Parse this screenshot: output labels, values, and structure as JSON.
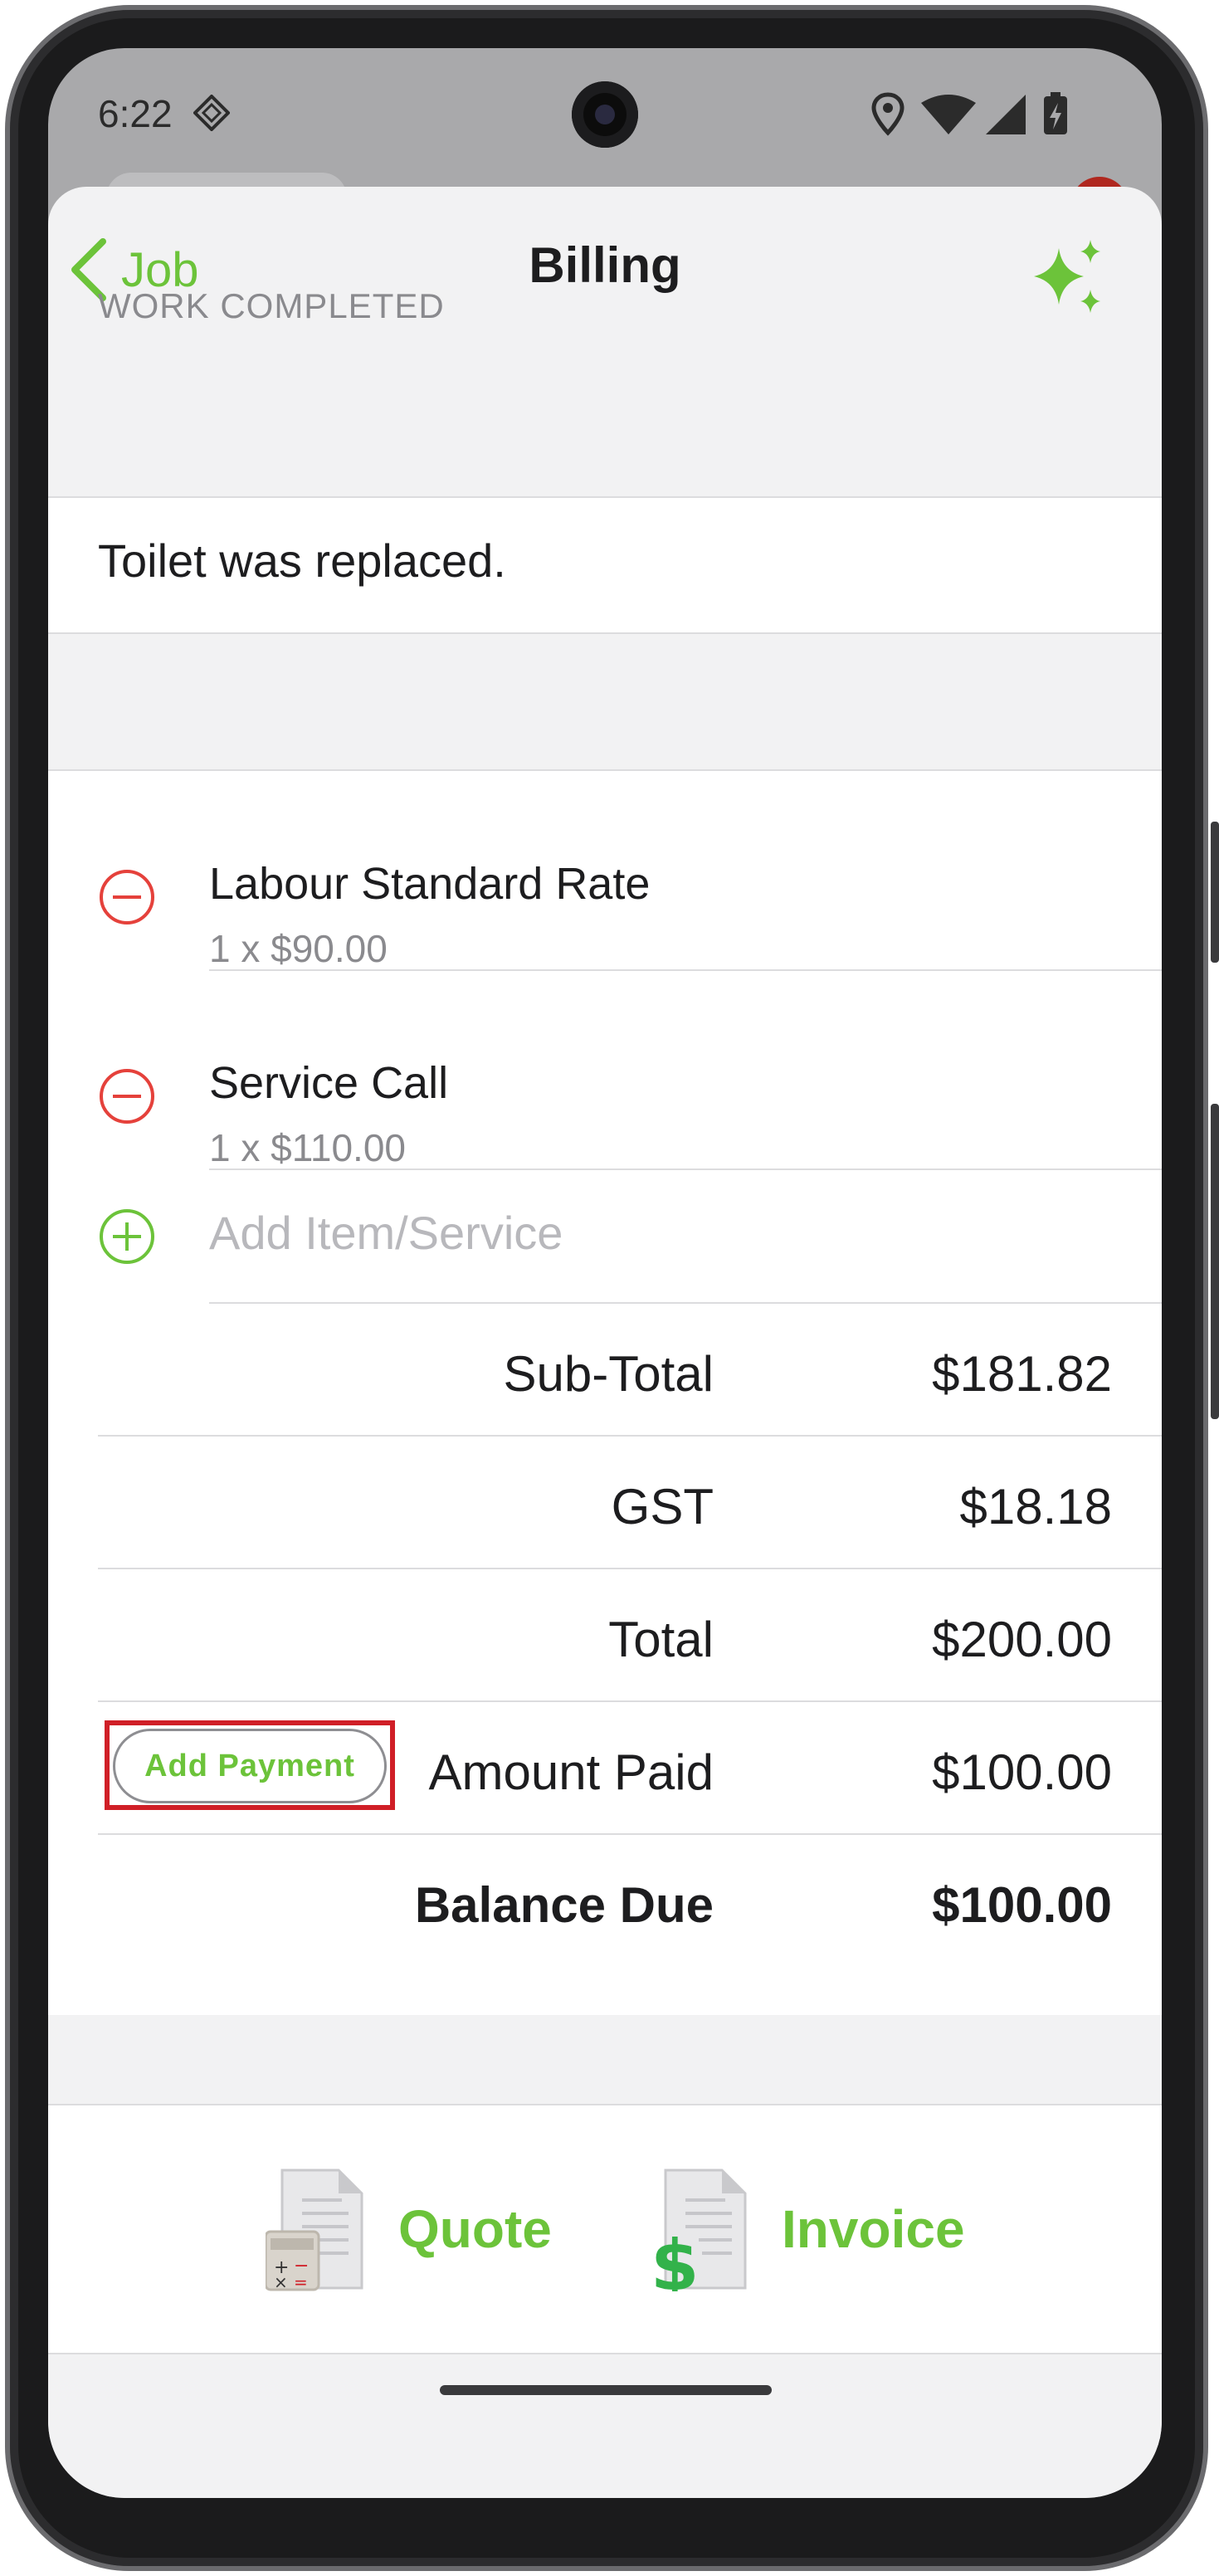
{
  "status_bar": {
    "time": "6:22"
  },
  "nav": {
    "back_label": "Job",
    "title": "Billing"
  },
  "work_completed": {
    "header": "WORK COMPLETED",
    "text": "Toilet was replaced."
  },
  "items": [
    {
      "title": "Labour Standard Rate",
      "detail": "1 x $90.00"
    },
    {
      "title": "Service Call",
      "detail": "1 x $110.00"
    }
  ],
  "add_item": {
    "placeholder": "Add Item/Service"
  },
  "totals": {
    "subtotal_label": "Sub-Total",
    "subtotal_value": "$181.82",
    "gst_label": "GST",
    "gst_value": "$18.18",
    "total_label": "Total",
    "total_value": "$200.00",
    "paid_label": "Amount Paid",
    "paid_value": "$100.00",
    "balance_label": "Balance Due",
    "balance_value": "$100.00"
  },
  "add_payment": {
    "label": "Add Payment"
  },
  "documents": {
    "quote_label": "Quote",
    "invoice_label": "Invoice"
  },
  "colors": {
    "accent": "#6cc33a",
    "remove": "#e5413b",
    "highlight": "#d01f27"
  }
}
